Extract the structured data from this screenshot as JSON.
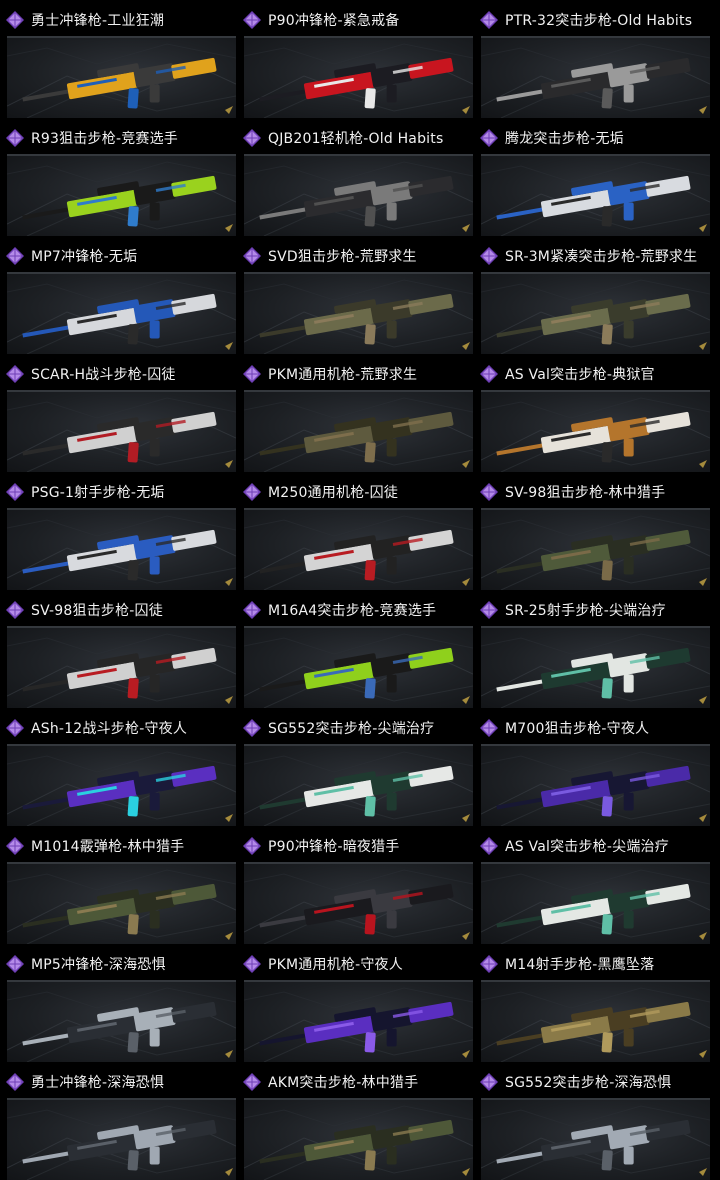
{
  "rarity_icon": "purple-diamond-icon",
  "colors": {
    "rarity": "#b48ae8",
    "rarity_dark": "#6e3fb6",
    "text": "#f2f2f2",
    "background": "#000000"
  },
  "items": [
    {
      "name": "勇士冲锋枪-工业狂潮",
      "skin": [
        "#e0a21c",
        "#3a3a3a",
        "#1e5fb8"
      ]
    },
    {
      "name": "P90冲锋枪-紧急戒备",
      "skin": [
        "#c8151f",
        "#1c1c22",
        "#e8e8e8"
      ]
    },
    {
      "name": "PTR-32突击步枪-Old Habits",
      "skin": [
        "#2a2a2c",
        "#9a9a9a",
        "#5a5a5a"
      ]
    },
    {
      "name": "R93狙击步枪-竞赛选手",
      "skin": [
        "#9ad21e",
        "#1a1a1a",
        "#2f7ccc"
      ]
    },
    {
      "name": "QJB201轻机枪-Old Habits",
      "skin": [
        "#2b2b2e",
        "#7a7a7a",
        "#505050"
      ]
    },
    {
      "name": "腾龙突击步枪-无垢",
      "skin": [
        "#d8dbe0",
        "#2a62c4",
        "#2a2a2a"
      ]
    },
    {
      "name": "MP7冲锋枪-无垢",
      "skin": [
        "#d6d8dc",
        "#2458b8",
        "#2a2a2a"
      ]
    },
    {
      "name": "SVD狙击步枪-荒野求生",
      "skin": [
        "#6b6a4a",
        "#3b3a2a",
        "#8a7a5a"
      ]
    },
    {
      "name": "SR-3M紧凑突击步枪-荒野求生",
      "skin": [
        "#6a6c4c",
        "#3a3c2c",
        "#8c7c5a"
      ]
    },
    {
      "name": "SCAR-H战斗步枪-囚徒",
      "skin": [
        "#d0d0d0",
        "#2a2a2a",
        "#b21c24"
      ]
    },
    {
      "name": "PKM通用机枪-荒野求生",
      "skin": [
        "#5e5a3e",
        "#34321f",
        "#7e6e4c"
      ]
    },
    {
      "name": "AS Val突击步枪-典狱官",
      "skin": [
        "#e6e2da",
        "#b4752c",
        "#2a2a2a"
      ]
    },
    {
      "name": "PSG-1射手步枪-无垢",
      "skin": [
        "#d8dade",
        "#2a5cc0",
        "#2a2a2a"
      ]
    },
    {
      "name": "M250通用机枪-囚徒",
      "skin": [
        "#d4d4d4",
        "#222222",
        "#b81c22"
      ]
    },
    {
      "name": "SV-98狙击步枪-林中猎手",
      "skin": [
        "#4f5a3a",
        "#2a2e22",
        "#7a6a48"
      ]
    },
    {
      "name": "SV-98狙击步枪-囚徒",
      "skin": [
        "#d0d0d0",
        "#262626",
        "#b81c22"
      ]
    },
    {
      "name": "M16A4突击步枪-竞赛选手",
      "skin": [
        "#8fd01c",
        "#1a1a1a",
        "#3a6ab8"
      ]
    },
    {
      "name": "SR-25射手步枪-尖端治疗",
      "skin": [
        "#1e3a30",
        "#e2e6e2",
        "#5fbfa6"
      ]
    },
    {
      "name": "ASh-12战斗步枪-守夜人",
      "skin": [
        "#5a2fc0",
        "#1a1a3a",
        "#2ad0e0"
      ]
    },
    {
      "name": "SG552突击步枪-尖端治疗",
      "skin": [
        "#e6e8e6",
        "#1f3a30",
        "#5fbfa6"
      ]
    },
    {
      "name": "M700狙击步枪-守夜人",
      "skin": [
        "#4a2aa8",
        "#171733",
        "#7a5ae0"
      ]
    },
    {
      "name": "M1014霰弹枪-林中猎手",
      "skin": [
        "#4d5838",
        "#2a2e20",
        "#8a7a50"
      ]
    },
    {
      "name": "P90冲锋枪-暗夜猎手",
      "skin": [
        "#1a1a1e",
        "#3a3a40",
        "#b8141e"
      ]
    },
    {
      "name": "AS Val突击步枪-尖端治疗",
      "skin": [
        "#e4e8e4",
        "#1f3a30",
        "#5fbfa6"
      ]
    },
    {
      "name": "MP5冲锋枪-深海恐惧",
      "skin": [
        "#2a2e34",
        "#a8b0b8",
        "#5a6068"
      ]
    },
    {
      "name": "PKM通用机枪-守夜人",
      "skin": [
        "#5a2ec0",
        "#15152e",
        "#8a5ae8"
      ]
    },
    {
      "name": "M14射手步枪-黑鹰坠落",
      "skin": [
        "#8a7a48",
        "#4a3e22",
        "#b09a5c"
      ]
    },
    {
      "name": "勇士冲锋枪-深海恐惧",
      "skin": [
        "#2a2e34",
        "#a0a8b2",
        "#5a6068"
      ]
    },
    {
      "name": "AKM突击步枪-林中猎手",
      "skin": [
        "#4e5838",
        "#2a2e20",
        "#8a7a50"
      ]
    },
    {
      "name": "SG552突击步枪-深海恐惧",
      "skin": [
        "#2a2e34",
        "#a2aab4",
        "#5a6068"
      ]
    }
  ]
}
